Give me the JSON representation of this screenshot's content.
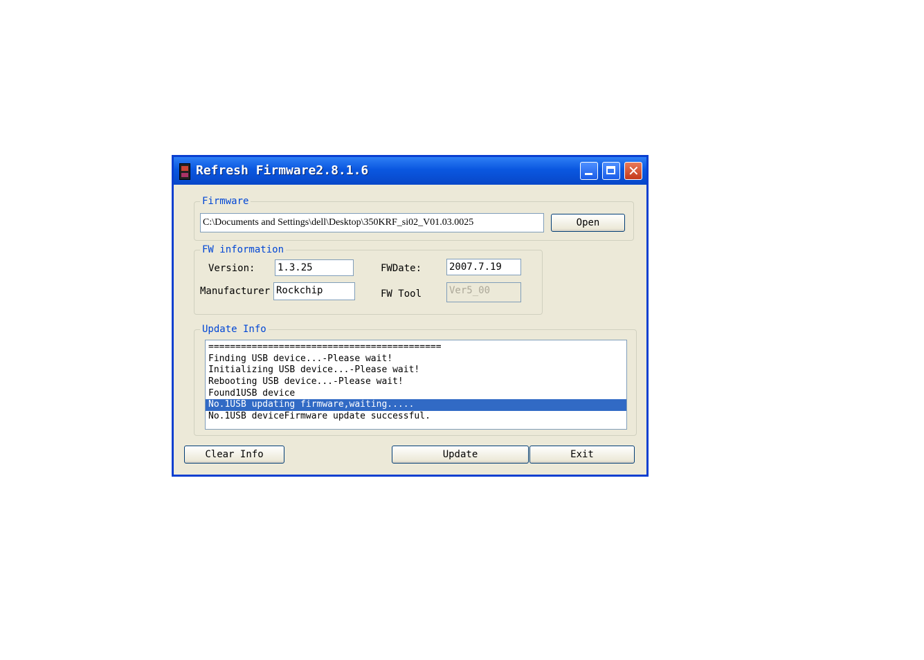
{
  "window": {
    "title": "Refresh Firmware2.8.1.6"
  },
  "firmware": {
    "legend": "Firmware",
    "path": "C:\\Documents and Settings\\dell\\Desktop\\350KRF_si02_V01.03.0025",
    "open_label": "Open"
  },
  "fw_info": {
    "legend": "FW information",
    "version_label": "Version:",
    "version_value": "1.3.25",
    "fwdate_label": "FWDate:",
    "fwdate_value": "2007.7.19",
    "manufacturer_label": "Manufacturer",
    "manufacturer_value": "Rockchip",
    "fwtool_label": "FW Tool",
    "fwtool_value": "Ver5_00"
  },
  "update_info": {
    "legend": "Update Info",
    "lines": [
      "===========================================",
      "Finding USB device...-Please wait!",
      "Initializing USB device...-Please wait!",
      "Rebooting USB device...-Please wait!",
      "Found1USB device",
      "No.1USB updating firmware,waiting.....",
      "No.1USB deviceFirmware update successful."
    ],
    "selected_index": 5
  },
  "buttons": {
    "clear_info": "Clear Info",
    "update": "Update",
    "exit": "Exit"
  }
}
